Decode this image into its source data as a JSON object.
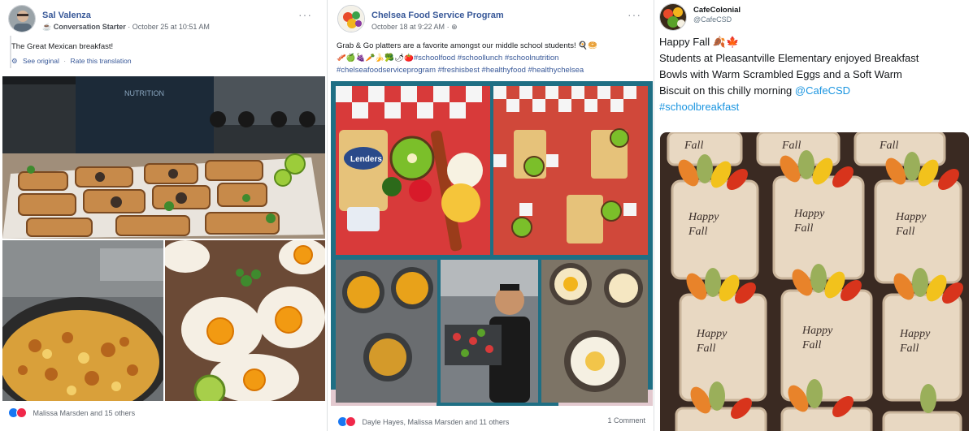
{
  "post1": {
    "author": "Sal Valenza",
    "badge": "Conversation Starter",
    "timestamp": "October 25 at 10:51 AM",
    "text": "The Great Mexican breakfast!",
    "see_original": "See original",
    "rate_translation": "Rate this translation",
    "reactions_text": "Malissa Marsden and 15 others"
  },
  "post2": {
    "author": "Chelsea Food Service Program",
    "timestamp": "October 18 at 9:22 AM",
    "text_line1": "Grab & Go platters are a favorite amongst our middle school students!",
    "hashtags1": "#schoolfood #schoollunch #schoolnutrition",
    "hashtags2": "#chelseafoodserviceprogram #freshisbest #healthyfood #healthychelsea",
    "reactions_text": "Dayle Hayes, Malissa Marsden and 11 others",
    "comments": "1 Comment"
  },
  "post3": {
    "author": "CafeColonial",
    "handle": "@CafeCSD",
    "line1": "Happy Fall",
    "line2": "Students at Pleasantville Elementary enjoyed Breakfast",
    "line3": "Bowls with Warm Scrambled Eggs and a Soft Warm",
    "line4_text": "Biscuit on this chilly morning",
    "mention": "@CafeCSD",
    "hashtag": "#schoolbreakfast",
    "label_text": "Happy Fall"
  },
  "colors": {
    "facebook_link": "#385898",
    "twitter_link": "#1b95e0",
    "like_blue": "#1877f2",
    "love_red": "#f0284a",
    "frame_teal": "#1f6f84"
  },
  "icons": [
    "more-dots-icon",
    "globe-icon",
    "mug-icon",
    "like-reaction-icon",
    "love-reaction-icon",
    "maple-leaf-icon"
  ]
}
